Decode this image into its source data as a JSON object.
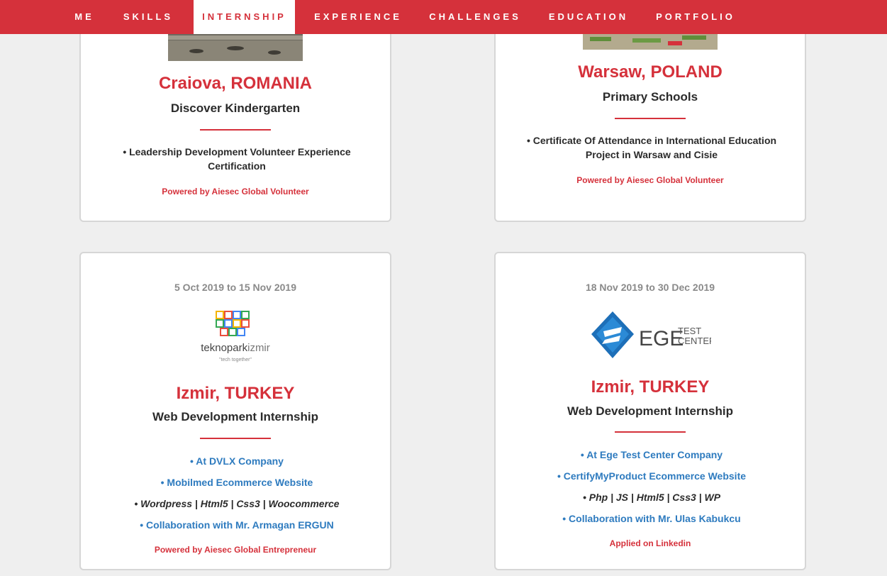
{
  "nav": {
    "items": [
      "ME",
      "SKILLS",
      "INTERNSHIP",
      "EXPERIENCE",
      "CHALLENGES",
      "EDUCATION",
      "PORTFOLIO"
    ],
    "active": "INTERNSHIP",
    "colors": {
      "bar": "#d5313b",
      "active_bg": "#ffffff"
    }
  },
  "cards": [
    {
      "city": "Craiova, ROMANIA",
      "role": "Discover Kindergarten",
      "bullets": [
        "• Leadership Development Volunteer Experience Certification"
      ],
      "footer": "Powered by Aiesec Global Volunteer"
    },
    {
      "city": "Warsaw, POLAND",
      "role": "Primary Schools",
      "bullets": [
        "• Certificate Of Attendance in International Education Project in Warsaw and Cisie"
      ],
      "footer": "Powered by Aiesec Global Volunteer"
    },
    {
      "date": "5 Oct 2019 to 15 Nov 2019",
      "logo": {
        "main": "teknopark",
        "accent": "izmir",
        "tagline": "\"tech together\""
      },
      "city": "Izmir, TURKEY",
      "role": "Web Development Internship",
      "bullets": [
        "• At DVLX Company",
        "• Mobilmed Ecommerce Website",
        "• Wordpress | Html5 | Css3 | Woocommerce",
        "• Collaboration with Mr. Armagan ERGUN"
      ],
      "footer": "Powered by Aiesec Global Entrepreneur"
    },
    {
      "date": "18 Nov 2019 to 30 Dec 2019",
      "logo": {
        "main": "EGE",
        "line1": "TEST",
        "line2": "CENTER"
      },
      "city": "Izmir, TURKEY",
      "role": "Web Development Internship",
      "bullets": [
        "• At Ege Test Center Company",
        "• CertifyMyProduct Ecommerce Website",
        "• Php | JS | Html5 | Css3 | WP",
        "• Collaboration with Mr. Ulas Kabukcu"
      ],
      "footer": "Applied on Linkedin"
    }
  ],
  "colors": {
    "accent": "#d5313b",
    "link": "#2e7bbf",
    "muted": "#8a8a8a",
    "page_bg": "#efefef"
  }
}
